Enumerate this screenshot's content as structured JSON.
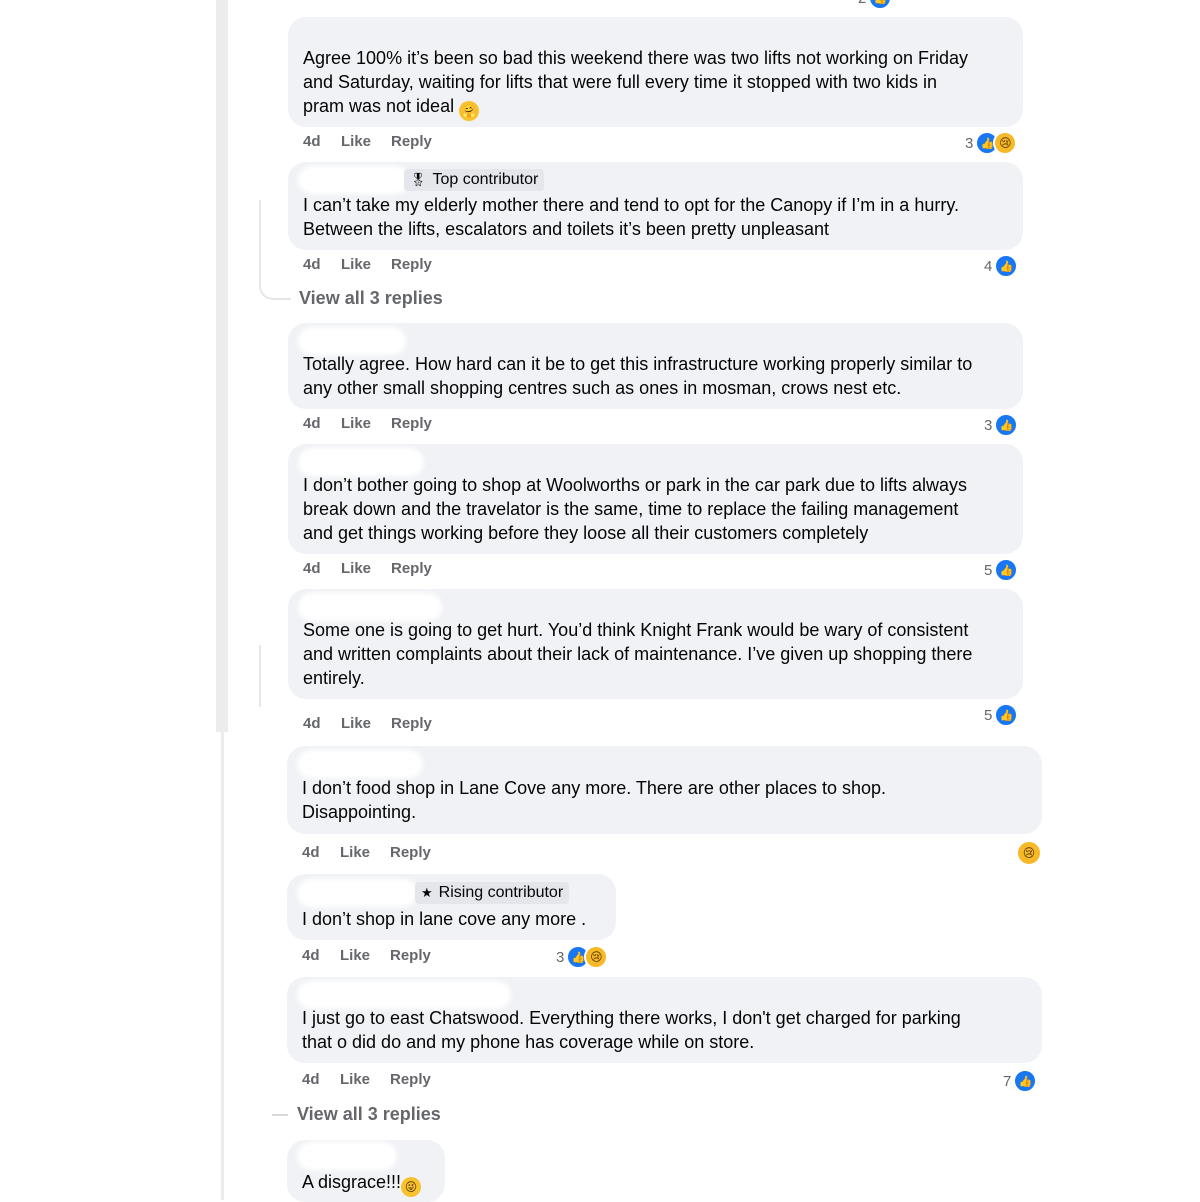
{
  "comments": [
    {
      "text": "Agree 100% it's been so bad this weekend there was two lifts not working on Friday and Saturday, waiting for lifts that were full every time it stopped with two kids in pram was not ideal",
      "text_l1": "Agree 100% it’s been so bad this weekend there was two lifts not working on Friday",
      "text_l2": "and Saturday, waiting for lifts that were full every time it stopped with two kids in",
      "text_l3": "pram was not ideal",
      "emoji": "hugging-face-emoji",
      "time": "4d",
      "like": "Like",
      "reply": "Reply",
      "reaction_count": "3",
      "reactions": [
        "like",
        "sad"
      ]
    },
    {
      "badge": "Top contributor",
      "badge_icon": "award-icon",
      "text_l1": "I can’t take my elderly mother there and tend to opt for the Canopy if I’m in a hurry.",
      "text_l2": "Between the lifts, escalators and toilets it’s been pretty unpleasant",
      "time": "4d",
      "like": "Like",
      "reply": "Reply",
      "reaction_count": "4",
      "reactions": [
        "like"
      ]
    },
    {
      "text_l1": "Totally agree. How hard can it be to get this infrastructure working properly similar to",
      "text_l2": "any other small shopping centres such as ones in mosman, crows nest etc.",
      "time": "4d",
      "like": "Like",
      "reply": "Reply",
      "reaction_count": "3",
      "reactions": [
        "like"
      ]
    },
    {
      "text_l1": "I don’t bother going to shop at Woolworths or park in the car park due to lifts always",
      "text_l2": "break down and the travelator is the same, time to replace the failing management",
      "text_l3": "and get things working before they loose all their customers completely",
      "time": "4d",
      "like": "Like",
      "reply": "Reply",
      "reaction_count": "5",
      "reactions": [
        "like"
      ]
    },
    {
      "text_l1": "Some one is going to get hurt. You’d think Knight Frank would be wary of consistent",
      "text_l2": "and written complaints about their lack of maintenance. I’ve given up shopping there",
      "text_l3": "entirely.",
      "time": "4d",
      "like": "Like",
      "reply": "Reply",
      "reaction_count": "5",
      "reactions": [
        "like"
      ]
    },
    {
      "text_l1": "I don’t food shop in Lane Cove any more. There are other places to shop.",
      "text_l2": "Disappointing.",
      "time": "4d",
      "like": "Like",
      "reply": "Reply",
      "reaction_count": "",
      "reactions": [
        "sad"
      ]
    },
    {
      "badge": "Rising contributor",
      "badge_icon": "star-icon",
      "text_l1": "I don’t shop in lane cove any more .",
      "time": "4d",
      "like": "Like",
      "reply": "Reply",
      "reaction_count": "3",
      "reactions": [
        "like",
        "sad"
      ]
    },
    {
      "text_l1": "I just go to east Chatswood. Everything there works, I don't get charged for parking",
      "text_l2": "that o did do and my phone has coverage while on store.",
      "time": "4d",
      "like": "Like",
      "reply": "Reply",
      "reaction_count": "7",
      "reactions": [
        "like"
      ]
    },
    {
      "text_l1": "A disgrace!!!",
      "emoji": "zany-face-emoji"
    }
  ],
  "view_replies_1": "View all 3 replies",
  "view_replies_2": "View all 3 replies",
  "colors": {
    "bubble": "#f0f2f5",
    "meta": "#65676b",
    "like_blue": "#1877f2",
    "sad_yellow": "#f7b928"
  }
}
